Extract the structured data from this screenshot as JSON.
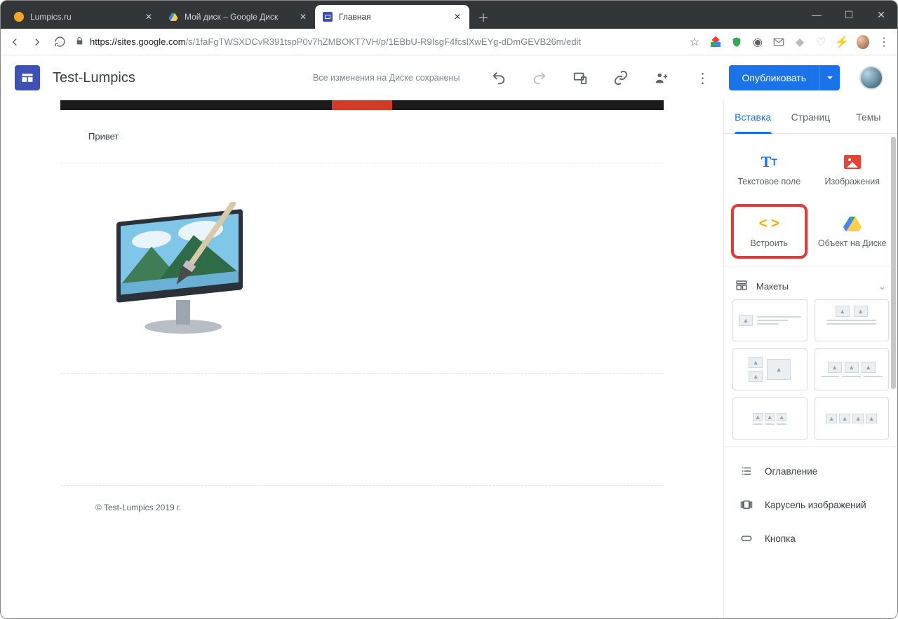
{
  "browser": {
    "tabs": [
      {
        "title": "Lumpics.ru"
      },
      {
        "title": "Мой диск – Google Диск"
      },
      {
        "title": "Главная"
      }
    ],
    "url_domain": "https://sites.google.com",
    "url_path": "/s/1faFgTWSXDCvR391tspP0v7hZMBOKT7VH/p/1EBbU-R9IsgF4fcslXwEYg-dDmGEVB26m/edit"
  },
  "app": {
    "title": "Test-Lumpics",
    "save_status": "Все изменения на Диске сохранены",
    "publish_label": "Опубликовать"
  },
  "canvas": {
    "greeting": "Привет",
    "footer": "© Test-Lumpics 2019 г."
  },
  "panel": {
    "tabs": {
      "insert": "Вставка",
      "pages": "Страниц",
      "themes": "Темы"
    },
    "tiles": {
      "textbox": "Текстовое поле",
      "images": "Изображения",
      "embed": "Встроить",
      "drive": "Объект на Диске"
    },
    "layouts_label": "Макеты",
    "more": {
      "toc": "Оглавление",
      "carousel": "Карусель изображений",
      "button": "Кнопка"
    }
  }
}
